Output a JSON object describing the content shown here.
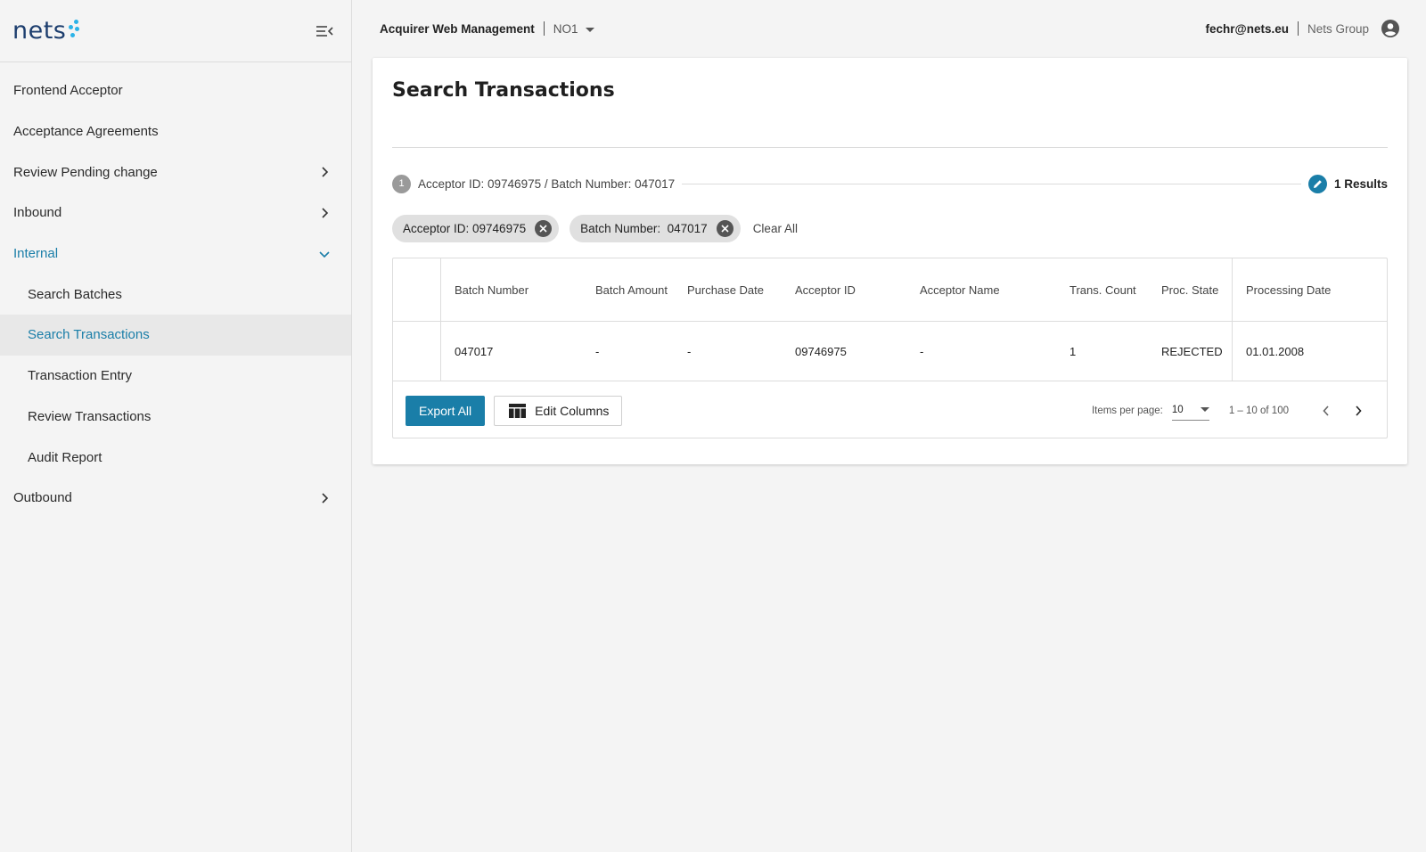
{
  "brand": {
    "logo_text": "nets",
    "accent": "#2cb3e8",
    "logo_color": "#1d3e6e"
  },
  "theme": {
    "primary": "#1a7ea8",
    "sidebar_bg": "#f4f4f4",
    "active_item_bg": "#e8e8e8"
  },
  "sidebar": {
    "items": [
      {
        "label": "Frontend Acceptor"
      },
      {
        "label": "Acceptance Agreements"
      },
      {
        "label": "Review Pending change",
        "icon": "chevron-right-icon"
      },
      {
        "label": "Inbound",
        "icon": "chevron-right-icon"
      },
      {
        "label": "Internal",
        "icon": "chevron-down-icon",
        "expanded": true
      },
      {
        "label": "Search Batches"
      },
      {
        "label": "Search Transactions",
        "active": true
      },
      {
        "label": "Transaction Entry"
      },
      {
        "label": "Review Transactions"
      },
      {
        "label": "Audit Report"
      },
      {
        "label": "Outbound",
        "icon": "chevron-right-icon"
      }
    ]
  },
  "header": {
    "app_title": "Acquirer Web Management",
    "environment": "NO1",
    "user_email": "fechr@nets.eu",
    "organization": "Nets Group"
  },
  "main": {
    "title": "Search Transactions",
    "step": {
      "number": "1",
      "summary": "Acceptor ID: 09746975 / Batch Number: 047017",
      "results": "1 Results"
    },
    "chips": [
      {
        "label": "Acceptor ID: 09746975"
      },
      {
        "label": "Batch Number:  047017"
      }
    ],
    "clear_all": "Clear All",
    "table": {
      "columns": [
        "Batch Number",
        "Batch Amount",
        "Purchase Date",
        "Acceptor ID",
        "Acceptor Name",
        "Trans. Count",
        "Proc. State",
        "Processing Date"
      ],
      "rows": [
        [
          "047017",
          "-",
          "-",
          "09746975",
          "-",
          "1",
          "REJECTED",
          "01.01.2008"
        ]
      ]
    },
    "actions": {
      "export_all": "Export All",
      "edit_columns": "Edit Columns"
    },
    "pagination": {
      "items_per_page_label": "Items per page:",
      "items_per_page": "10",
      "range": "1 – 10 of 100"
    }
  }
}
